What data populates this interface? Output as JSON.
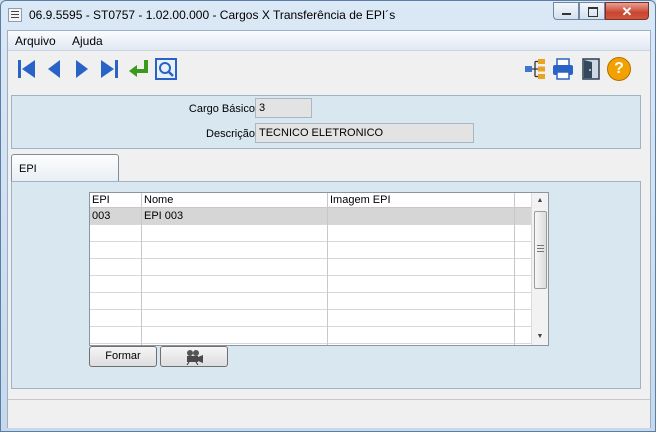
{
  "window": {
    "title": "06.9.5595 - ST0757 - 1.02.00.000 - Cargos X Transferência de EPI´s",
    "close_label": "✕"
  },
  "menu": {
    "items": [
      "Arquivo",
      "Ajuda"
    ]
  },
  "toolbar": {
    "left_icons": [
      "first-record-icon",
      "previous-record-icon",
      "next-record-icon",
      "last-record-icon",
      "return-icon",
      "zoom-icon"
    ],
    "right_icons": [
      "tree-structure-icon",
      "print-icon",
      "exit-door-icon",
      "help-icon"
    ],
    "help_label": "?"
  },
  "form": {
    "cargo_label": "Cargo Básico:",
    "cargo_value": "3",
    "descricao_label": "Descrição:",
    "descricao_value": "TECNICO ELETRONICO"
  },
  "tabs": [
    {
      "label": "EPI",
      "active": true
    }
  ],
  "grid": {
    "columns": [
      "EPI",
      "Nome",
      "Imagem EPI"
    ],
    "rows": [
      [
        "003",
        "EPI 003",
        ""
      ],
      [
        "",
        "",
        ""
      ],
      [
        "",
        "",
        ""
      ],
      [
        "",
        "",
        ""
      ],
      [
        "",
        "",
        ""
      ],
      [
        "",
        "",
        ""
      ],
      [
        "",
        "",
        ""
      ],
      [
        "",
        "",
        ""
      ]
    ],
    "scroll_up": "▲",
    "scroll_down": "▼"
  },
  "buttons": {
    "formar_label": "Formar",
    "camera_icon": "film-camera-icon"
  },
  "colors": {
    "panel": "#d9e7f1",
    "selected_row": "#d6d6d6",
    "help_icon": "#f2a100"
  }
}
